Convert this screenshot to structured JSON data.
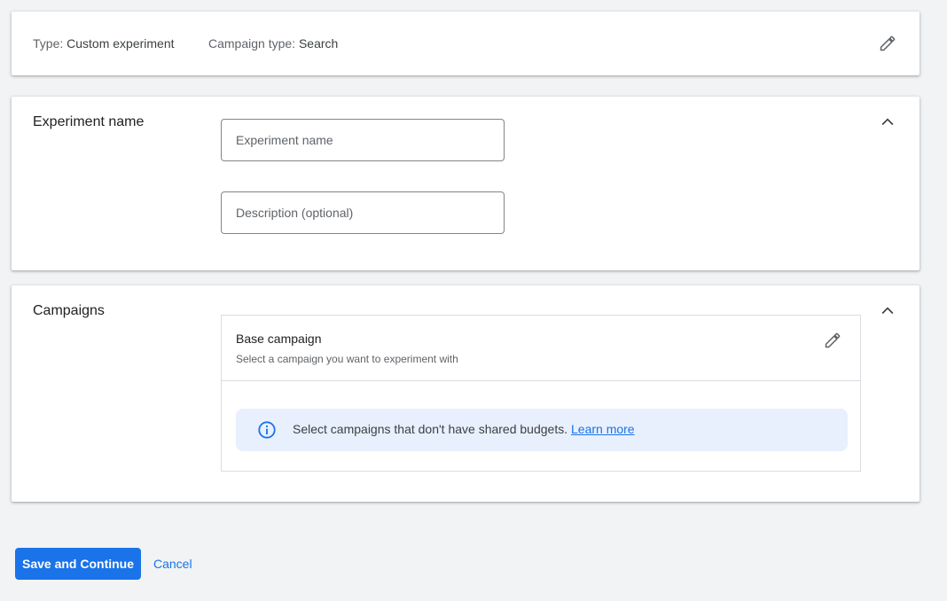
{
  "summary": {
    "type_label": "Type:",
    "type_value": "Custom experiment",
    "campaign_type_label": "Campaign type:",
    "campaign_type_value": "Search",
    "edit_icon": "pencil-icon"
  },
  "experiment_section": {
    "title": "Experiment name",
    "name_field": {
      "value": "",
      "placeholder": "Experiment name"
    },
    "description_field": {
      "value": "",
      "placeholder": "Description (optional)"
    },
    "collapse_icon": "chevron-up-icon"
  },
  "campaigns_section": {
    "title": "Campaigns",
    "collapse_icon": "chevron-up-icon",
    "base_campaign": {
      "title": "Base campaign",
      "subtitle": "Select a campaign you want to experiment with",
      "edit_icon": "pencil-icon"
    },
    "info_banner": {
      "icon": "info-icon",
      "text": "Select campaigns that don't have shared budgets.",
      "link": "Learn more"
    }
  },
  "footer": {
    "save_label": "Save and Continue",
    "cancel_label": "Cancel"
  },
  "colors": {
    "primary": "#1a73e8",
    "background": "#f1f3f4",
    "banner_bg": "#e8f0fe"
  }
}
